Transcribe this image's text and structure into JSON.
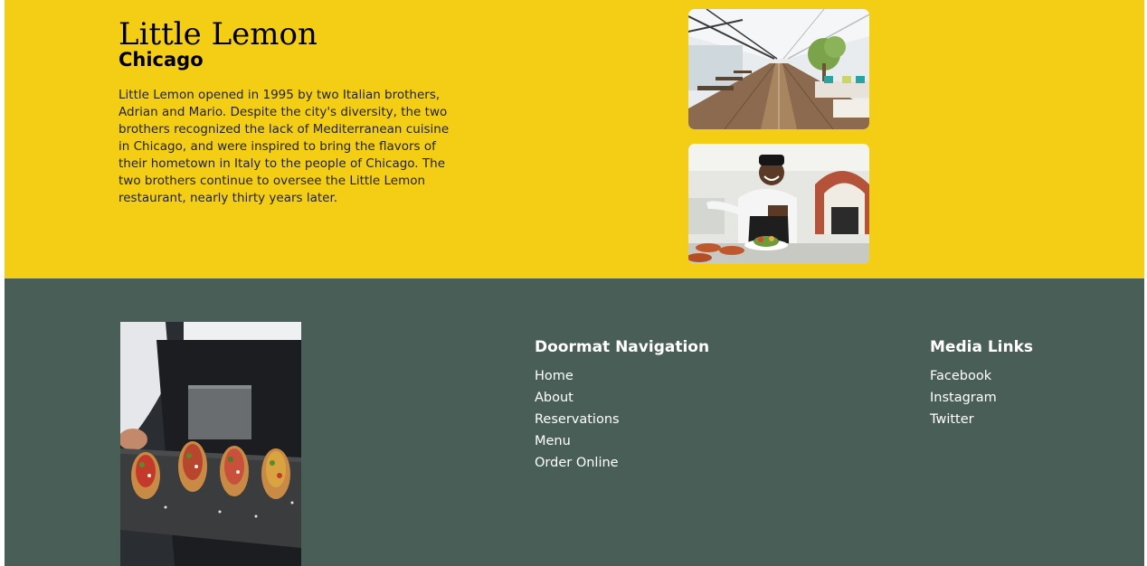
{
  "about": {
    "title": "Little Lemon",
    "subtitle": "Chicago",
    "description": "Little Lemon opened in 1995 by two Italian brothers, Adrian and Mario. Despite the city's diversity, the two brothers recognized the lack of Mediterranean cuisine in Chicago, and were inspired to bring the flavors of their hometown in Italy to the people of Chicago. The two brothers continue to oversee the Little Lemon restaurant, nearly thirty years later.",
    "images": [
      "restaurant-interior-photo",
      "chef-plating-photo"
    ]
  },
  "footer": {
    "image": "bruschetta-platter-photo",
    "doormat": {
      "heading": "Doormat Navigation",
      "links": [
        "Home",
        "About",
        "Reservations",
        "Menu",
        "Order Online"
      ]
    },
    "media": {
      "heading": "Media Links",
      "links": [
        "Facebook",
        "Instagram",
        "Twitter"
      ]
    }
  },
  "colors": {
    "primary_yellow": "#f4ce14",
    "primary_green": "#495e57",
    "text_dark": "#000000",
    "text_light": "#ffffff"
  }
}
